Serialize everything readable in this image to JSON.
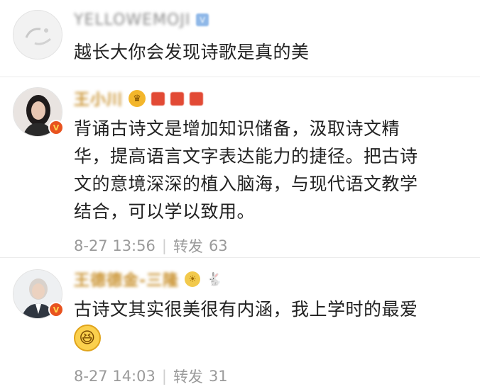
{
  "comments": [
    {
      "username": "YELLOWEMOJI",
      "level_badge": "V",
      "text_lines": [
        "越长大你会发现诗歌是真的美"
      ]
    },
    {
      "username": "王小川",
      "text_lines": [
        "背诵古诗文是增加知识储备，汲取诗文精",
        "华，提高语言文字表达能力的捷径。把古诗",
        "文的意境深深的植入脑海，与现代语文教学",
        "结合，可以学以致用。"
      ],
      "time": "8-27 13:56",
      "separator": "|",
      "repost_label": "转发",
      "repost_count": "63"
    },
    {
      "username": "王德德金-三隆",
      "text_lines": [
        "古诗文其实很美很有内涵，我上学时的最爱"
      ],
      "time": "8-27 14:03",
      "separator": "|",
      "repost_label": "转发",
      "repost_count": "31"
    }
  ],
  "icons": {
    "verified_badge": "V",
    "crown": "♛",
    "sun": "☀",
    "rabbit": "🐇",
    "laugh": "😆"
  },
  "colors": {
    "text": "#222222",
    "meta": "#9a9a9a",
    "divider": "#ececec",
    "gold_name": "#c9912e"
  }
}
